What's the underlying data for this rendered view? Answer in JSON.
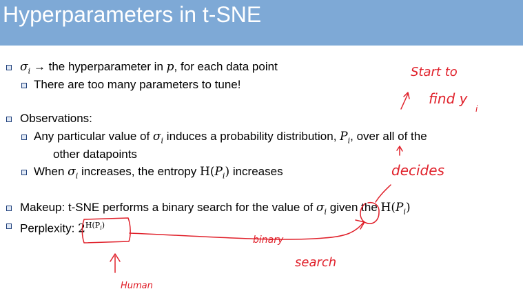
{
  "slide": {
    "title": "Hyperparameters in t-SNE",
    "bullets": {
      "b1_pre": "σ",
      "b1_sub": "i",
      "b1_arrow": "→",
      "b1_text": " the hyperparameter in ",
      "b1_p": "p",
      "b1_rest": ", for each data point",
      "b1a": "There are too many parameters to tune!",
      "b2": "Observations:",
      "b2a_pre": "Any particular value of ",
      "b2a_sigma": "σ",
      "b2a_sub": "i",
      "b2a_mid": " induces a probability distribution, ",
      "b2a_P": "P",
      "b2a_Psub": "i",
      "b2a_end": ", over all of the",
      "b2a_line2": "other datapoints",
      "b2b_pre": "When ",
      "b2b_sigma": "σ",
      "b2b_sub": "i",
      "b2b_mid": " increases, the entropy ",
      "b2b_H": "H(",
      "b2b_P": "P",
      "b2b_Psub": "i",
      "b2b_close": ")",
      "b2b_end": " increases",
      "b3_pre": "Makeup: t-SNE performs a binary search for the value of ",
      "b3_sigma": "σ",
      "b3_sub": "i",
      "b3_mid": " given the ",
      "b3_H": "H(",
      "b3_P": "P",
      "b3_Psub": "i",
      "b3_close": ")",
      "b4_pre": "Perplexity: ",
      "b4_base": "2",
      "b4_exp": "H(P",
      "b4_expsub": "i",
      "b4_expclose": ")"
    }
  },
  "annotations": {
    "start_to": "Start to",
    "find_yi": "find y",
    "find_yi_sub": "i",
    "decides": "decides",
    "binary": "binary",
    "search": "search",
    "human": "Human"
  },
  "colors": {
    "header": "#7ea9d6",
    "ink": "#e0202a",
    "bullet_box": "#1f3f7a"
  }
}
